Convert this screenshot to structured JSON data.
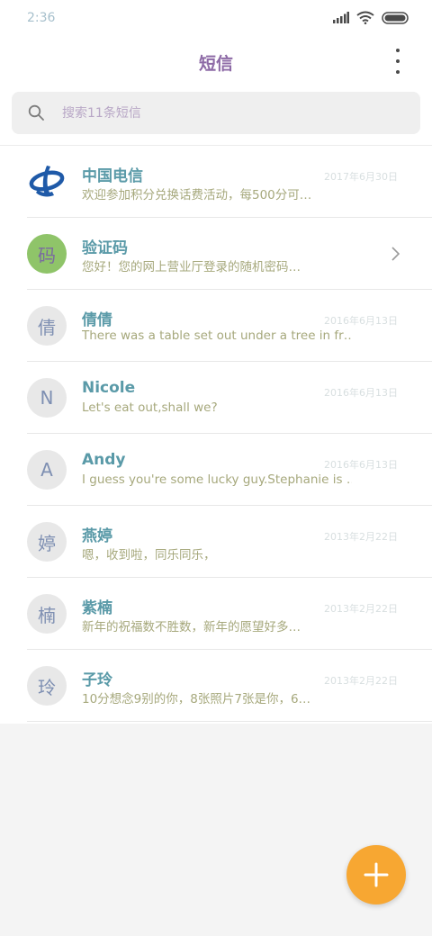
{
  "status_bar": {
    "time": "2:36"
  },
  "header": {
    "title": "短信",
    "more_icon": "more-vertical-icon"
  },
  "search": {
    "placeholder": "搜索11条短信",
    "icon": "search-icon"
  },
  "conversations": [
    {
      "name": "中国电信",
      "preview": "欢迎参加积分兑换话费活动，每500分可…",
      "date": "2017年6月30日",
      "avatar": "china-telecom-logo"
    },
    {
      "name": "验证码",
      "preview": "您好！您的网上营业厅登录的随机密码…",
      "avatar_char": "码",
      "indicator": "chevron-right-icon"
    },
    {
      "name": "倩倩",
      "preview": "There was a table set out under a tree in fr…",
      "date": "2016年6月13日",
      "avatar_char": "倩"
    },
    {
      "name": "Nicole",
      "preview": "Let's eat out,shall we?",
      "date": "2016年6月13日",
      "avatar_char": "N"
    },
    {
      "name": "Andy",
      "preview": "I guess you're some lucky guy.Stephanie is …",
      "date": "2016年6月13日",
      "avatar_char": "A"
    },
    {
      "name": "燕婷",
      "preview": "嗯，收到啦，同乐同乐，",
      "date": "2013年2月22日",
      "avatar_char": "婷"
    },
    {
      "name": "紫楠",
      "preview": "新年的祝福数不胜数，新年的愿望好多…",
      "date": "2013年2月22日",
      "avatar_char": "楠"
    },
    {
      "name": "子玲",
      "preview": "10分想念9别的你，8张照片7张是你，6…",
      "date": "2013年2月22日",
      "avatar_char": "玲"
    }
  ],
  "fab": {
    "icon": "plus-icon"
  },
  "colors": {
    "accent": "#f7a732",
    "title": "#8d6aa6",
    "name": "#5a9aa8",
    "preview": "#a6a87c",
    "date": "#d8dfe0"
  }
}
